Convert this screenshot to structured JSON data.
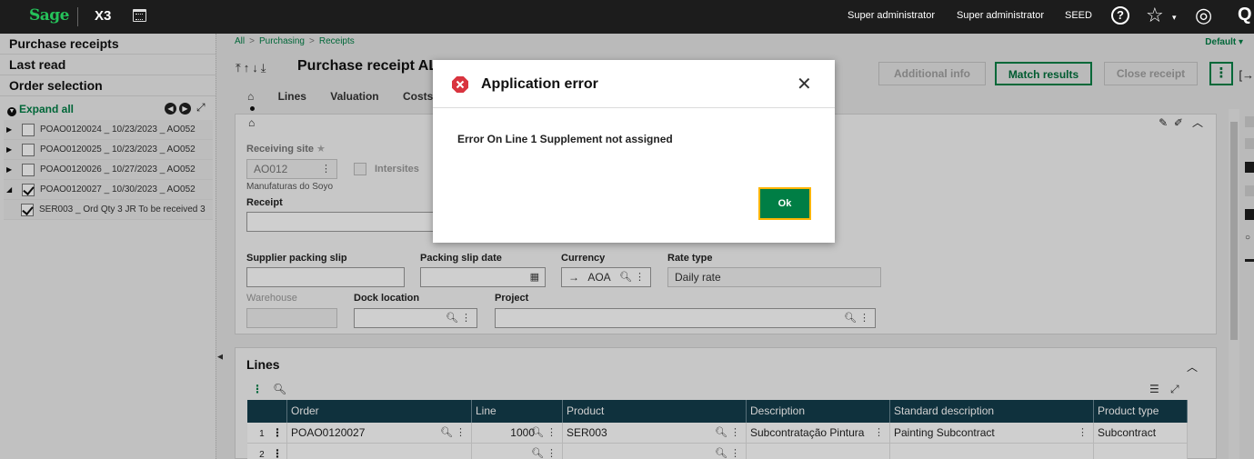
{
  "topbar": {
    "logo": "Sage",
    "product": "X3",
    "user1": "Super administrator",
    "user2": "Super administrator",
    "folder": "SEED",
    "help_glyph": "?",
    "star_glyph": "☆",
    "compass_glyph": "◎",
    "search_glyph": "Q"
  },
  "left_panel": {
    "sections": [
      "Purchase receipts",
      "Last read",
      "Order selection"
    ],
    "expand_label": "Expand all",
    "tree": [
      {
        "label": "POAO0120024 _ 10/23/2023 _ AO052",
        "checked": false,
        "expanded": false
      },
      {
        "label": "POAO0120025 _ 10/23/2023 _ AO052",
        "checked": false,
        "expanded": false
      },
      {
        "label": "POAO0120026 _ 10/27/2023 _ AO052",
        "checked": false,
        "expanded": false
      },
      {
        "label": "POAO0120027 _ 10/30/2023 _ AO052",
        "checked": true,
        "expanded": true
      },
      {
        "label": "SER003 _ Ord Qty 3 JR To be received 3",
        "checked": true,
        "child": true
      }
    ]
  },
  "breadcrumb": {
    "items": [
      "All",
      "Purchasing",
      "Receipts"
    ],
    "default_label": "Default"
  },
  "page": {
    "title": "Purchase receipt AL"
  },
  "buttons": {
    "additional_info": "Additional info",
    "match_results": "Match results",
    "close_receipt": "Close receipt",
    "more": "⋮"
  },
  "tabs": [
    "Lines",
    "Valuation",
    "Costs"
  ],
  "header_form": {
    "receiving_site_label": "Receiving site",
    "receiving_site_value": "AO012",
    "receiving_site_desc": "Manufaturas do Soyo",
    "intersites_label": "Intersites",
    "receipt_label": "Receipt",
    "receipt_value": "",
    "supplier_packing_slip_label": "Supplier packing slip",
    "packing_slip_date_label": "Packing slip date",
    "currency_label": "Currency",
    "currency_value": "AOA",
    "currency_arrow": "→",
    "rate_type_label": "Rate type",
    "rate_type_value": "Daily rate",
    "warehouse_label": "Warehouse",
    "dock_location_label": "Dock location",
    "project_label": "Project"
  },
  "lines": {
    "title": "Lines",
    "columns": [
      "Order",
      "Line",
      "Product",
      "Description",
      "Standard description",
      "Product type"
    ],
    "rows": [
      {
        "num": "1",
        "order": "POAO0120027",
        "line": "1000",
        "product": "SER003",
        "description": "Subcontratação Pintura",
        "std_description": "Painting Subcontract",
        "product_type": "Subcontract"
      },
      {
        "num": "2",
        "order": "",
        "line": "",
        "product": "",
        "description": "",
        "std_description": "",
        "product_type": ""
      }
    ]
  },
  "dialog": {
    "title": "Application error",
    "message": "Error On Line 1 Supplement not assigned",
    "ok_label": "Ok",
    "close_glyph": "✕",
    "error_color": "#d9343f"
  }
}
